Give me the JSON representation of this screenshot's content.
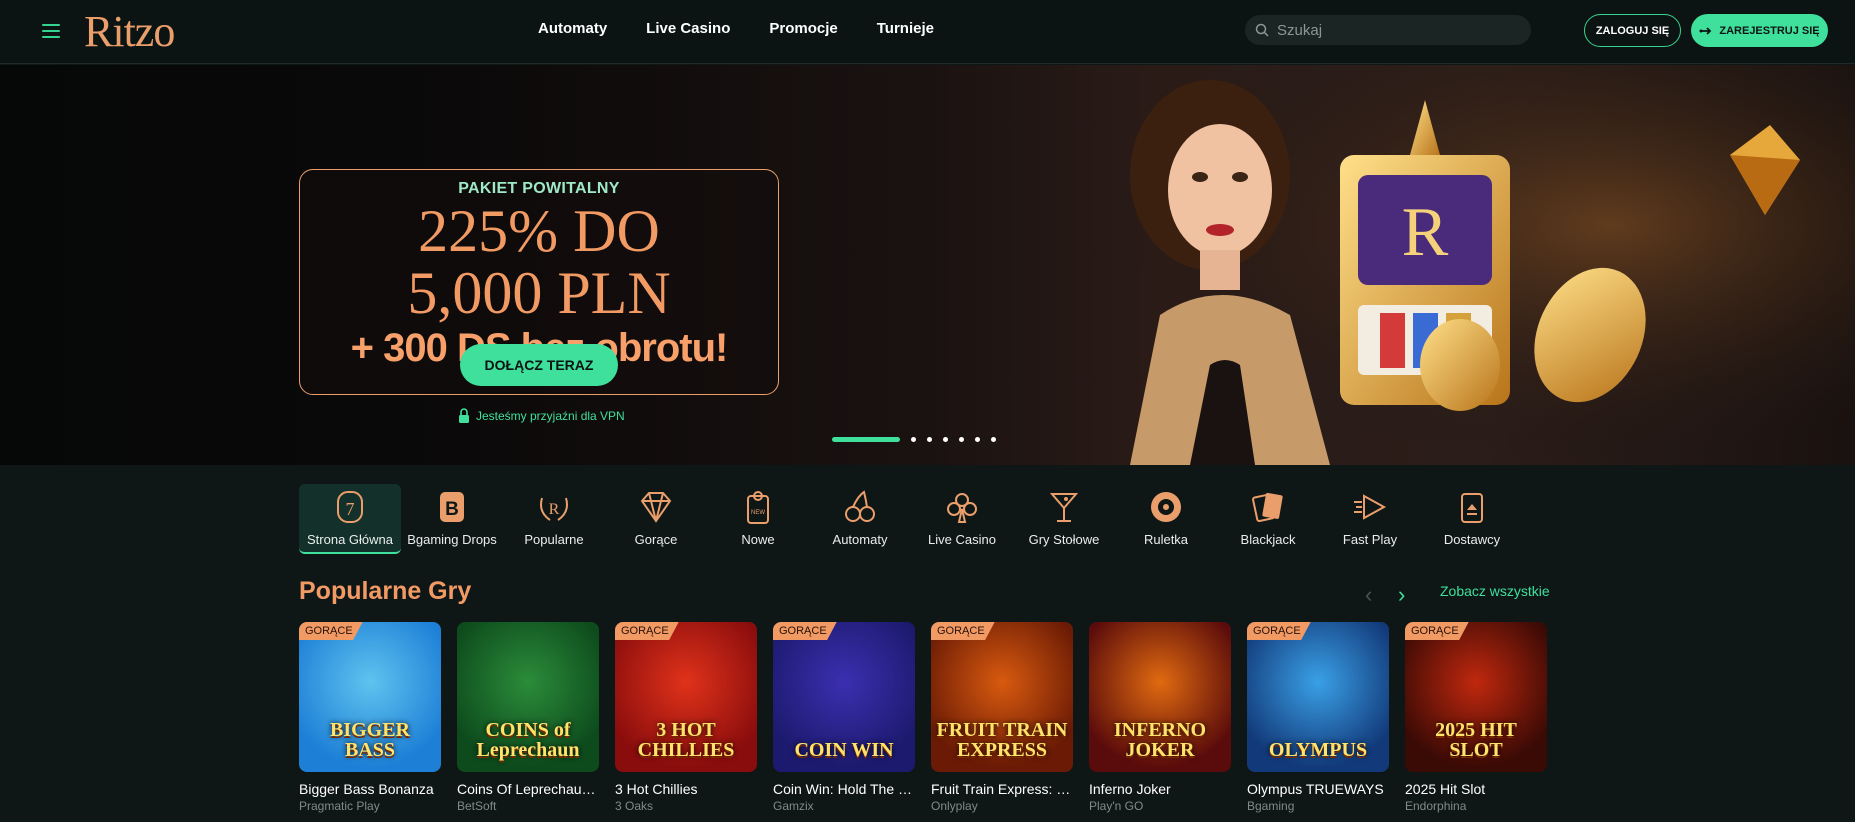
{
  "header": {
    "logo": "Ritzo",
    "nav": [
      "Automaty",
      "Live Casino",
      "Promocje",
      "Turnieje"
    ],
    "search_placeholder": "Szukaj",
    "login_label": "ZALOGUJ SIĘ",
    "register_label": "ZAREJESTRUJ SIĘ"
  },
  "hero": {
    "kicker": "PAKIET POWITALNY",
    "headline_1": "225% DO",
    "headline_2": "5,000 PLN",
    "subline": "+ 300 DS bez obrotu!",
    "cta": "DOŁĄCZ TERAZ",
    "vpn_text": "Jesteśmy przyjaźni dla VPN",
    "slides_total": 7,
    "active_slide": 1
  },
  "categories": [
    {
      "label": "Strona Główna",
      "icon": "slot-seven-icon",
      "active": true
    },
    {
      "label": "Bgaming Drops",
      "icon": "b-badge-icon",
      "active": false
    },
    {
      "label": "Popularne",
      "icon": "laurel-r-icon",
      "active": false
    },
    {
      "label": "Gorące",
      "icon": "diamond-icon",
      "active": false
    },
    {
      "label": "Nowe",
      "icon": "new-tag-icon",
      "active": false
    },
    {
      "label": "Automaty",
      "icon": "cherry-icon",
      "active": false
    },
    {
      "label": "Live Casino",
      "icon": "club-icon",
      "active": false
    },
    {
      "label": "Gry Stołowe",
      "icon": "cocktail-icon",
      "active": false
    },
    {
      "label": "Ruletka",
      "icon": "roulette-icon",
      "active": false
    },
    {
      "label": "Blackjack",
      "icon": "cards-icon",
      "active": false
    },
    {
      "label": "Fast Play",
      "icon": "fast-play-icon",
      "active": false
    },
    {
      "label": "Dostawcy",
      "icon": "provider-icon",
      "active": false
    }
  ],
  "popular": {
    "title": "Popularne Gry",
    "see_all": "Zobacz wszystkie",
    "hot_label": "GORĄCE",
    "games": [
      {
        "name": "Bigger Bass Bonanza",
        "provider": "Pragmatic Play",
        "hot": true,
        "art": "BIGGER BASS",
        "c1": "#1d7fd6",
        "c2": "#5fc3ef"
      },
      {
        "name": "Coins Of Leprechaun ...",
        "provider": "BetSoft",
        "hot": false,
        "art": "COINS of Leprechaun",
        "c1": "#0d4a1c",
        "c2": "#2b8c3a"
      },
      {
        "name": "3 Hot Chillies",
        "provider": "3 Oaks",
        "hot": true,
        "art": "3 HOT CHILLIES",
        "c1": "#8a0d0d",
        "c2": "#e0321a"
      },
      {
        "name": "Coin Win: Hold The S...",
        "provider": "Gamzix",
        "hot": true,
        "art": "COIN WIN",
        "c1": "#1c1a6e",
        "c2": "#3b2fb0"
      },
      {
        "name": "Fruit Train Express: H...",
        "provider": "Onlyplay",
        "hot": true,
        "art": "FRUIT TRAIN EXPRESS",
        "c1": "#6a1a05",
        "c2": "#d85a0f"
      },
      {
        "name": "Inferno Joker",
        "provider": "Play'n GO",
        "hot": false,
        "art": "INFERNO JOKER",
        "c1": "#5a0b0b",
        "c2": "#e06a10"
      },
      {
        "name": "Olympus TRUEWAYS",
        "provider": "Bgaming",
        "hot": true,
        "art": "OLYMPUS",
        "c1": "#123a7a",
        "c2": "#3aa0e6"
      },
      {
        "name": "2025 Hit Slot",
        "provider": "Endorphina",
        "hot": true,
        "art": "2025 HIT SLOT",
        "c1": "#3a0a05",
        "c2": "#c0280e"
      }
    ]
  },
  "colors": {
    "accent_green": "#3ee09b",
    "accent_orange": "#f19a64",
    "background": "#0f1716"
  }
}
